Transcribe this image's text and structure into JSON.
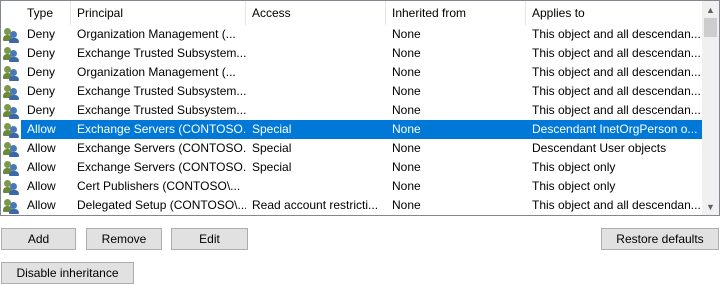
{
  "columns": {
    "type": "Type",
    "principal": "Principal",
    "access": "Access",
    "inherited_from": "Inherited from",
    "applies_to": "Applies to"
  },
  "entries": [
    {
      "type": "Deny",
      "principal": "Organization Management (...",
      "access": "",
      "inherited_from": "None",
      "applies_to": "This object and all descendan..."
    },
    {
      "type": "Deny",
      "principal": "Exchange Trusted Subsystem...",
      "access": "",
      "inherited_from": "None",
      "applies_to": "This object and all descendan..."
    },
    {
      "type": "Deny",
      "principal": "Organization Management (...",
      "access": "",
      "inherited_from": "None",
      "applies_to": "This object and all descendan..."
    },
    {
      "type": "Deny",
      "principal": "Exchange Trusted Subsystem...",
      "access": "",
      "inherited_from": "None",
      "applies_to": "This object and all descendan..."
    },
    {
      "type": "Deny",
      "principal": "Exchange Trusted Subsystem...",
      "access": "",
      "inherited_from": "None",
      "applies_to": "This object and all descendan..."
    },
    {
      "type": "Allow",
      "principal": "Exchange Servers (CONTOSO...",
      "access": "Special",
      "inherited_from": "None",
      "applies_to": "Descendant InetOrgPerson o...",
      "selected": true
    },
    {
      "type": "Allow",
      "principal": "Exchange Servers (CONTOSO...",
      "access": "Special",
      "inherited_from": "None",
      "applies_to": "Descendant User objects"
    },
    {
      "type": "Allow",
      "principal": "Exchange Servers (CONTOSO...",
      "access": "Special",
      "inherited_from": "None",
      "applies_to": "This object only"
    },
    {
      "type": "Allow",
      "principal": "Cert Publishers (CONTOSO\\...",
      "access": "",
      "inherited_from": "None",
      "applies_to": "This object only"
    },
    {
      "type": "Allow",
      "principal": "Delegated Setup (CONTOSO\\...",
      "access": "Read account restricti...",
      "inherited_from": "None",
      "applies_to": "This object and all descendan..."
    }
  ],
  "icons": {
    "entry_icon": "users-icon",
    "scroll_up": "chevron-up-icon",
    "scroll_down": "chevron-down-icon"
  },
  "buttons": {
    "add": "Add",
    "remove": "Remove",
    "edit": "Edit",
    "restore_defaults": "Restore defaults",
    "disable_inheritance": "Disable inheritance"
  },
  "colors": {
    "selection": "#0078d7",
    "button_bg": "#e1e1e1",
    "button_border": "#adadad"
  }
}
